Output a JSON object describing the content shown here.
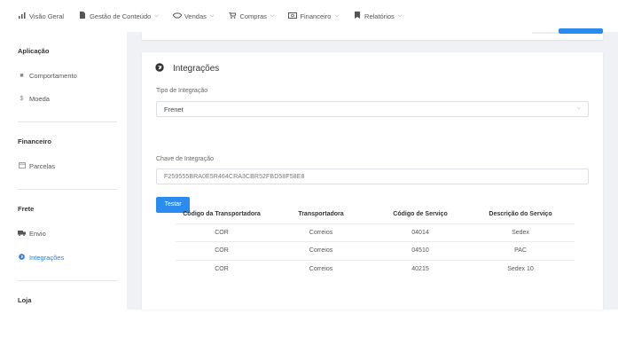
{
  "nav": {
    "items": [
      {
        "label": "Visão Geral",
        "icon": "bar-chart-icon",
        "has_menu": false
      },
      {
        "label": "Gestão de Conteúdo",
        "icon": "file-icon",
        "has_menu": true
      },
      {
        "label": "Vendas",
        "icon": "handshake-icon",
        "has_menu": true
      },
      {
        "label": "Compras",
        "icon": "cart-icon",
        "has_menu": true
      },
      {
        "label": "Financeiro",
        "icon": "money-icon",
        "has_menu": true
      },
      {
        "label": "Relatórios",
        "icon": "bookmark-icon",
        "has_menu": true
      }
    ]
  },
  "sidebar": {
    "sections": [
      {
        "heading": "Aplicação",
        "items": [
          {
            "label": "Comportamento",
            "icon": "square-icon"
          },
          {
            "label": "Moeda",
            "icon": "dollar-icon"
          }
        ]
      },
      {
        "heading": "Financeiro",
        "items": [
          {
            "label": "Parcelas",
            "icon": "calendar-icon"
          }
        ]
      },
      {
        "heading": "Frete",
        "items": [
          {
            "label": "Envio",
            "icon": "truck-icon"
          },
          {
            "label": "Integrações",
            "icon": "globe-icon",
            "active": true
          }
        ]
      },
      {
        "heading": "Loja",
        "items": []
      }
    ]
  },
  "card": {
    "title": "Integrações",
    "type_label": "Tipo de Integração",
    "type_value": "Frenet",
    "key_label": "Chave de Integração",
    "key_value": "F259555BRA0E5R464CRA3CBR52FBD58F58E8",
    "test_button": "Testar"
  },
  "table": {
    "headers": [
      "Código da Transportadora",
      "Transportadora",
      "Código de Serviço",
      "Descrição do Serviço"
    ],
    "rows": [
      [
        "COR",
        "Correios",
        "04014",
        "Sedex"
      ],
      [
        "COR",
        "Correios",
        "04510",
        "PAC"
      ],
      [
        "COR",
        "Correios",
        "40215",
        "Sedex 10"
      ]
    ]
  },
  "colors": {
    "accent": "#2c8bef",
    "active_link": "#2c7be5",
    "background": "#eff1f4"
  }
}
